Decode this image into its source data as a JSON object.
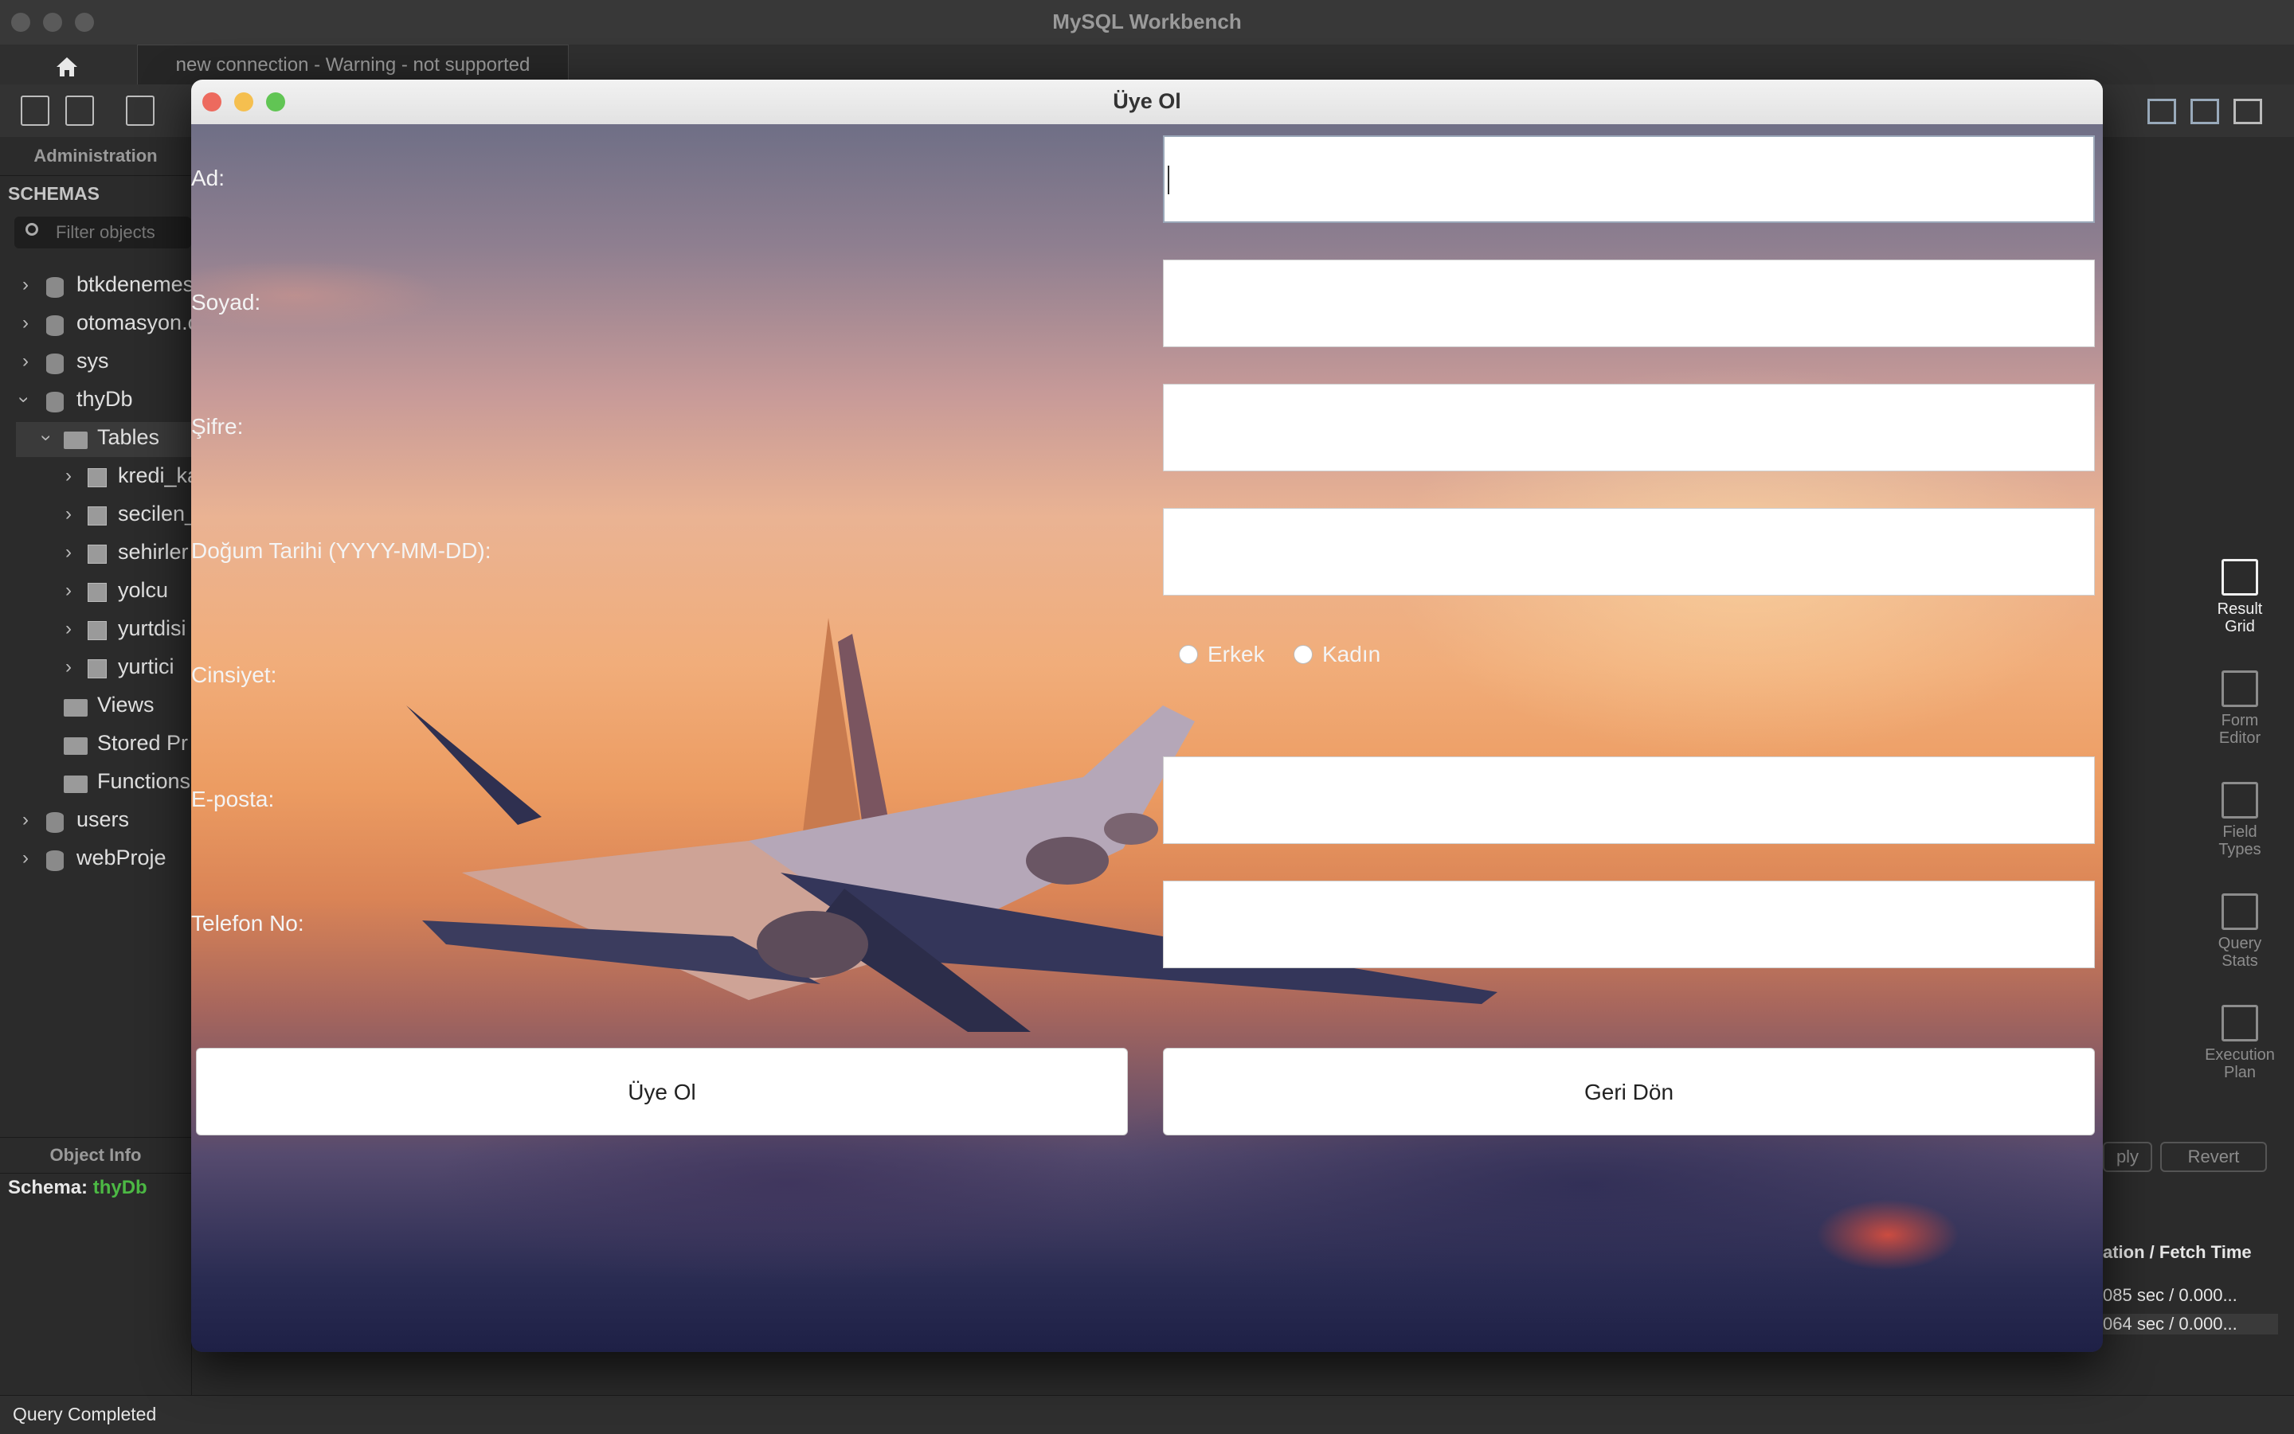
{
  "window": {
    "title": "MySQL Workbench"
  },
  "tabs": {
    "connection": "new connection - Warning - not supported"
  },
  "sidebar": {
    "administration_label": "Administration",
    "schemas_label": "SCHEMAS",
    "filter_placeholder": "Filter objects",
    "tree": {
      "btkdenemes": "btkdenemes",
      "otomasyon": "otomasyon.c",
      "sys": "sys",
      "thyDb": "thyDb",
      "tables": "Tables",
      "kredi": "kredi_ka",
      "secilen": "secilen_",
      "sehirler": "sehirler",
      "yolcu": "yolcu",
      "yurtdisi": "yurtdisi",
      "yurtici": "yurtici",
      "views": "Views",
      "stored": "Stored Pr",
      "functions": "Functions",
      "users": "users",
      "webproje": "webProje"
    },
    "object_info_label": "Object Info",
    "schema_key": "Schema:",
    "schema_value": "thyDb"
  },
  "right_panel": {
    "result_grid": [
      "Result",
      "Grid"
    ],
    "form_editor": [
      "Form",
      "Editor"
    ],
    "field_types": [
      "Field",
      "Types"
    ],
    "query_stats": [
      "Query",
      "Stats"
    ],
    "execution_plan": [
      "Execution",
      "Plan"
    ],
    "apply": "ply",
    "revert": "Revert",
    "exec_header": "ation / Fetch Time",
    "exec_rows": [
      "085 sec / 0.000...",
      "064 sec / 0.000..."
    ]
  },
  "status": {
    "text": "Query Completed"
  },
  "dialog": {
    "title": "Üye Ol",
    "labels": {
      "ad": "Ad:",
      "soyad": "Soyad:",
      "sifre": "Şifre:",
      "dogum": "Doğum Tarihi (YYYY-MM-DD):",
      "cinsiyet": "Cinsiyet:",
      "eposta": "E-posta:",
      "telefon": "Telefon No:"
    },
    "gender_options": [
      "Erkek",
      "Kadın"
    ],
    "register_button": "Üye Ol",
    "back_button": "Geri Dön"
  },
  "colors": {
    "schema_value": "#4cb944",
    "close": "#ed6a5e",
    "minimize": "#f5bf4f",
    "maximize": "#61c554"
  }
}
